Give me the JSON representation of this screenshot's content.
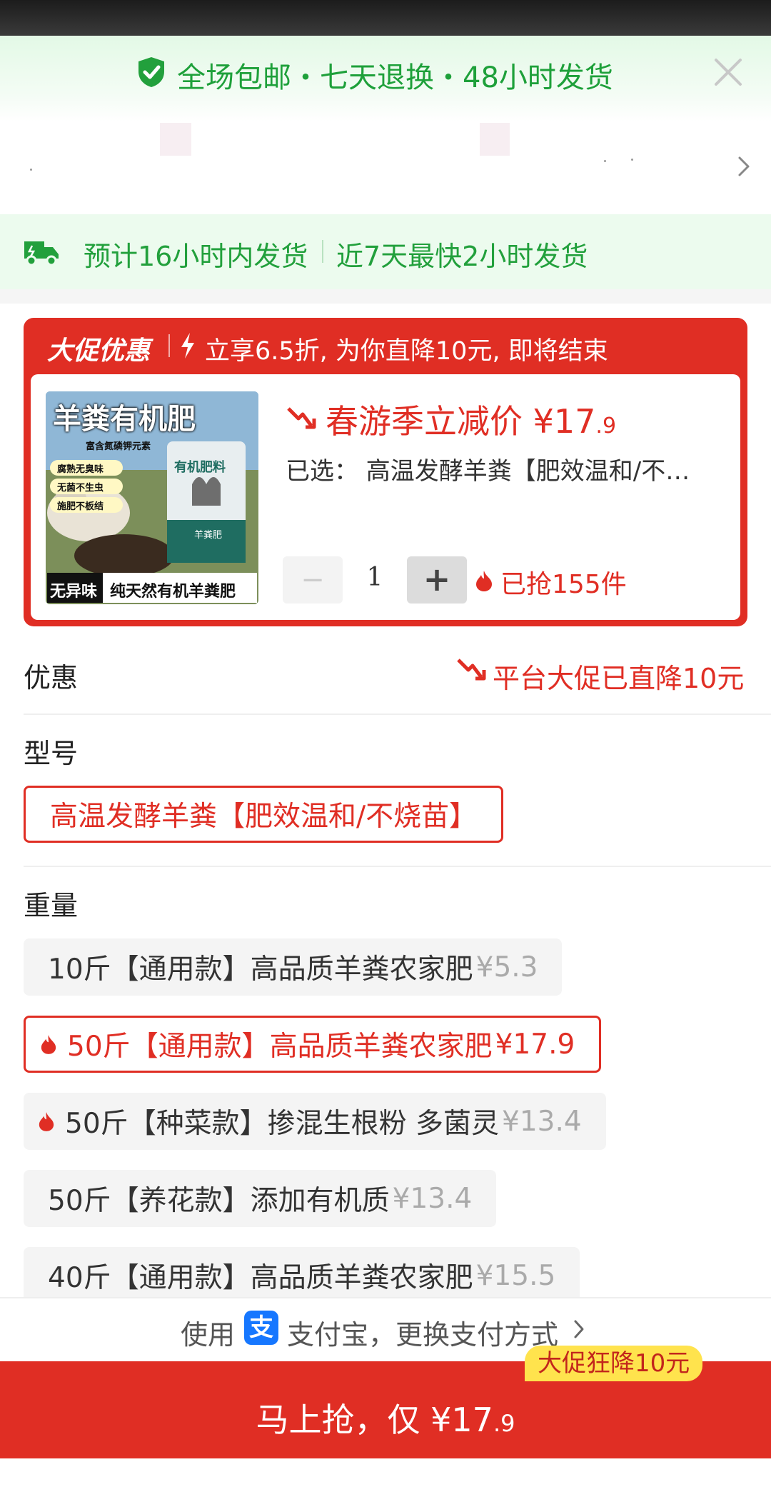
{
  "banner": {
    "promise_text": "全场包邮・七天退换・48小时发货"
  },
  "shipping": {
    "estimate": "预计16小时内发货",
    "fastest": "近7天最快2小时发货"
  },
  "promo": {
    "badge": "大促优惠",
    "headline": "立享6.5折, 为你直降10元, 即将结束",
    "product_image_title": "羊粪有机肥",
    "product_image_sub": "富含氮磷钾元素",
    "product_image_bag": "有机肥料",
    "product_image_bag_label": "羊粪肥",
    "product_image_features": [
      "腐熟无臭味",
      "无菌不生虫",
      "施肥不板结"
    ],
    "product_image_footer_dark": "无异味",
    "product_image_footer_text": "纯天然有机羊粪肥",
    "price_label": "春游季立减价 ¥17",
    "price_decimal": ".9",
    "selected": "已选： 高温发酵羊粪【肥效温和/不…",
    "quantity": "1",
    "minus_label": "−",
    "plus_label": "+",
    "sold": "已抢155件"
  },
  "discount": {
    "label": "优惠",
    "value": "平台大促已直降10元"
  },
  "model": {
    "label": "型号",
    "option": "高温发酵羊粪【肥效温和/不烧苗】"
  },
  "weight": {
    "label": "重量",
    "options": [
      {
        "text": "10斤【通用款】高品质羊粪农家肥",
        "price": "¥5.3",
        "selected": false,
        "hot": false
      },
      {
        "text": "50斤【通用款】高品质羊粪农家肥",
        "price": "¥17.9",
        "selected": true,
        "hot": true
      },
      {
        "text": "50斤【种菜款】掺混生根粉 多菌灵",
        "price": "¥13.4",
        "selected": false,
        "hot": true
      },
      {
        "text": "50斤【养花款】添加有机质",
        "price": "¥13.4",
        "selected": false,
        "hot": false
      },
      {
        "text": "40斤【通用款】高品质羊粪农家肥",
        "price": "¥15.5",
        "selected": false,
        "hot": false
      }
    ]
  },
  "payment": {
    "prefix": "使用",
    "icon_glyph": "支",
    "text": "支付宝，更换支付方式"
  },
  "buy": {
    "tag": "大促狂降10元",
    "label": "马上抢，仅 ¥17",
    "decimal": ".9"
  },
  "colors": {
    "accent_red": "#e02e24",
    "success_green": "#22a03c",
    "alipay_blue": "#1677ff",
    "tag_yellow": "#ffe34d"
  }
}
